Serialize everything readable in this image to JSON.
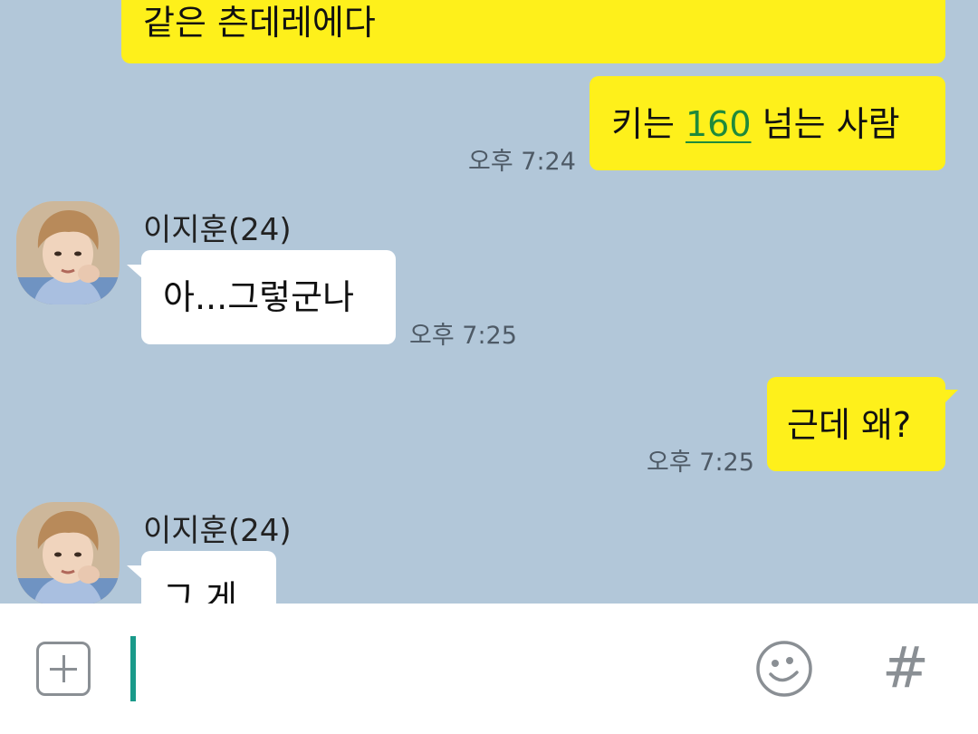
{
  "messages": [
    {
      "side": "mine",
      "text": "같은 츤데레에다"
    },
    {
      "side": "mine",
      "text_before": "키는 ",
      "link": "160",
      "text_after": " 넘는 사람",
      "time": "오후 7:24"
    },
    {
      "side": "theirs",
      "sender": "이지훈(24)",
      "text": "아...그렇군나",
      "time": "오후 7:25"
    },
    {
      "side": "mine",
      "text": "근데 왜?",
      "time": "오후 7:25"
    },
    {
      "side": "theirs",
      "sender": "이지훈(24)",
      "text": "그 게"
    }
  ],
  "input": {
    "value": "",
    "placeholder": ""
  },
  "icons": {
    "add": "plus-square-icon",
    "emoticon": "smiley-icon",
    "hashtag": "#"
  },
  "colors": {
    "chat_background": "#b2c7d9",
    "my_bubble": "#fef01b",
    "their_bubble": "#ffffff",
    "link": "#1f8a3b",
    "cursor": "#1a9a8a"
  }
}
